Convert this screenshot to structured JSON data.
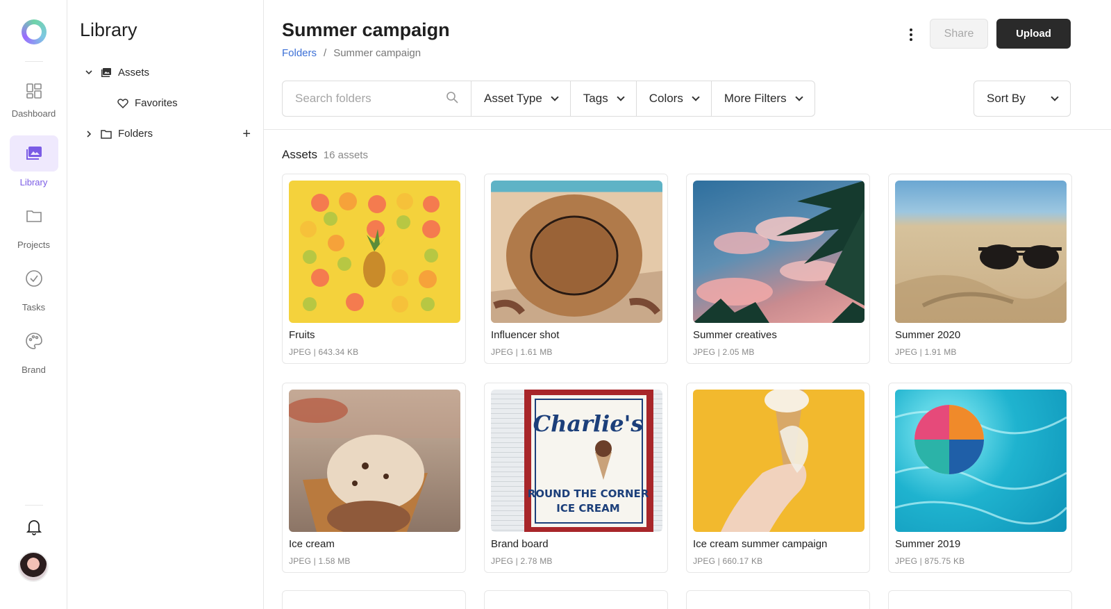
{
  "colors": {
    "accent": "#7b5ce5",
    "link": "#3b6fd6",
    "primary_button": "#2a2a2a"
  },
  "rail": {
    "items": [
      {
        "label": "Dashboard",
        "icon": "dashboard-grid-icon"
      },
      {
        "label": "Library",
        "icon": "library-images-icon",
        "active": true
      },
      {
        "label": "Projects",
        "icon": "folder-icon"
      },
      {
        "label": "Tasks",
        "icon": "check-circle-icon"
      },
      {
        "label": "Brand",
        "icon": "palette-icon"
      }
    ]
  },
  "library": {
    "title": "Library",
    "tree": [
      {
        "label": "Assets",
        "icon": "images-icon",
        "expanded": true
      },
      {
        "label": "Favorites",
        "icon": "heart-icon"
      },
      {
        "label": "Folders",
        "icon": "folder-icon",
        "expanded": false
      }
    ]
  },
  "header": {
    "title": "Summer campaign",
    "breadcrumb": {
      "root": "Folders",
      "separator": "/",
      "current": "Summer campaign"
    },
    "share_label": "Share",
    "upload_label": "Upload"
  },
  "filters": {
    "search_placeholder": "Search folders",
    "asset_type": "Asset Type",
    "tags": "Tags",
    "colors": "Colors",
    "more": "More Filters",
    "sort": "Sort By"
  },
  "assets": {
    "heading": "Assets",
    "count_label": "16 assets",
    "items": [
      {
        "title": "Fruits",
        "meta": "JPEG | 643.34 KB"
      },
      {
        "title": "Influencer shot",
        "meta": "JPEG | 1.61 MB"
      },
      {
        "title": "Summer creatives",
        "meta": "JPEG | 2.05 MB"
      },
      {
        "title": "Summer 2020",
        "meta": "JPEG | 1.91 MB"
      },
      {
        "title": "Ice cream",
        "meta": "JPEG | 1.58 MB"
      },
      {
        "title": "Brand board",
        "meta": "JPEG | 2.78 MB"
      },
      {
        "title": "Ice cream summer campaign",
        "meta": "JPEG | 660.17 KB"
      },
      {
        "title": "Summer 2019",
        "meta": "JPEG | 875.75 KB"
      }
    ],
    "brand_sign": {
      "line1": "Charlie's",
      "line2": "ROUND THE CORNER",
      "line3": "ICE CREAM"
    }
  }
}
